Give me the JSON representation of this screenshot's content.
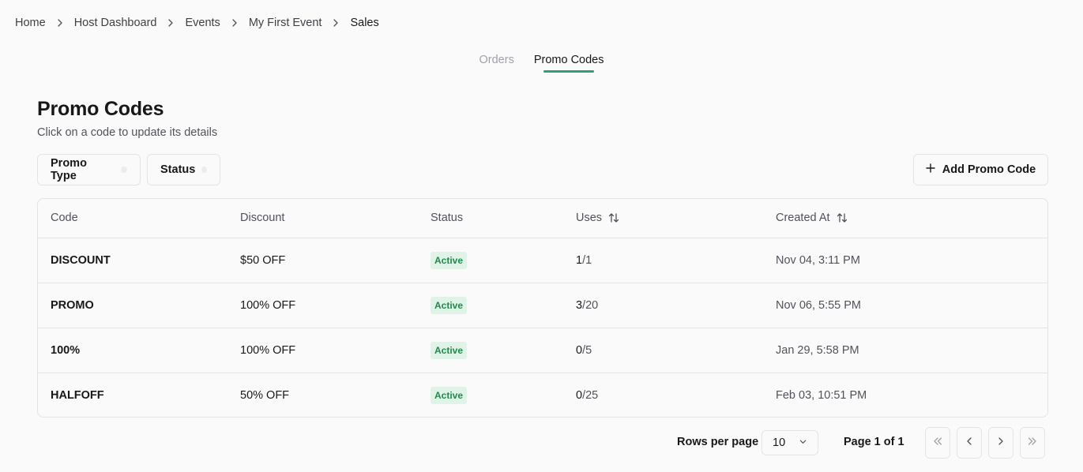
{
  "breadcrumb": {
    "items": [
      {
        "label": "Home"
      },
      {
        "label": "Host Dashboard"
      },
      {
        "label": "Events"
      },
      {
        "label": "My First Event"
      },
      {
        "label": "Sales"
      }
    ]
  },
  "tabs": [
    {
      "label": "Orders",
      "active": false
    },
    {
      "label": "Promo Codes",
      "active": true
    }
  ],
  "page": {
    "title": "Promo Codes",
    "subtitle": "Click on a code to update its details"
  },
  "filters": {
    "promo_type_label": "Promo Type",
    "status_label": "Status"
  },
  "actions": {
    "add_label": "Add Promo Code",
    "add_icon": "plus-icon"
  },
  "table": {
    "columns": {
      "code": "Code",
      "discount": "Discount",
      "status": "Status",
      "uses": "Uses",
      "created": "Created At"
    },
    "rows": [
      {
        "code": "DISCOUNT",
        "discount": "$50 OFF",
        "status": "Active",
        "uses_used": "1",
        "uses_total": "/1",
        "created": "Nov 04, 3:11 PM"
      },
      {
        "code": "PROMO",
        "discount": "100% OFF",
        "status": "Active",
        "uses_used": "3",
        "uses_total": "/20",
        "created": "Nov 06, 5:55 PM"
      },
      {
        "code": "100%",
        "discount": "100% OFF",
        "status": "Active",
        "uses_used": "0",
        "uses_total": "/5",
        "created": "Jan 29, 5:58 PM"
      },
      {
        "code": "HALFOFF",
        "discount": "50% OFF",
        "status": "Active",
        "uses_used": "0",
        "uses_total": "/25",
        "created": "Feb 03, 10:51 PM"
      }
    ]
  },
  "pagination": {
    "rows_per_page_label": "Rows per page",
    "rows_per_page_value": "10",
    "page_info": "Page 1 of 1"
  },
  "colors": {
    "accent": "#2e9f7a",
    "badge_bg": "#dff3e6",
    "badge_text": "#1f8a4c",
    "background": "#fafafa",
    "border": "#e4e4e7"
  }
}
